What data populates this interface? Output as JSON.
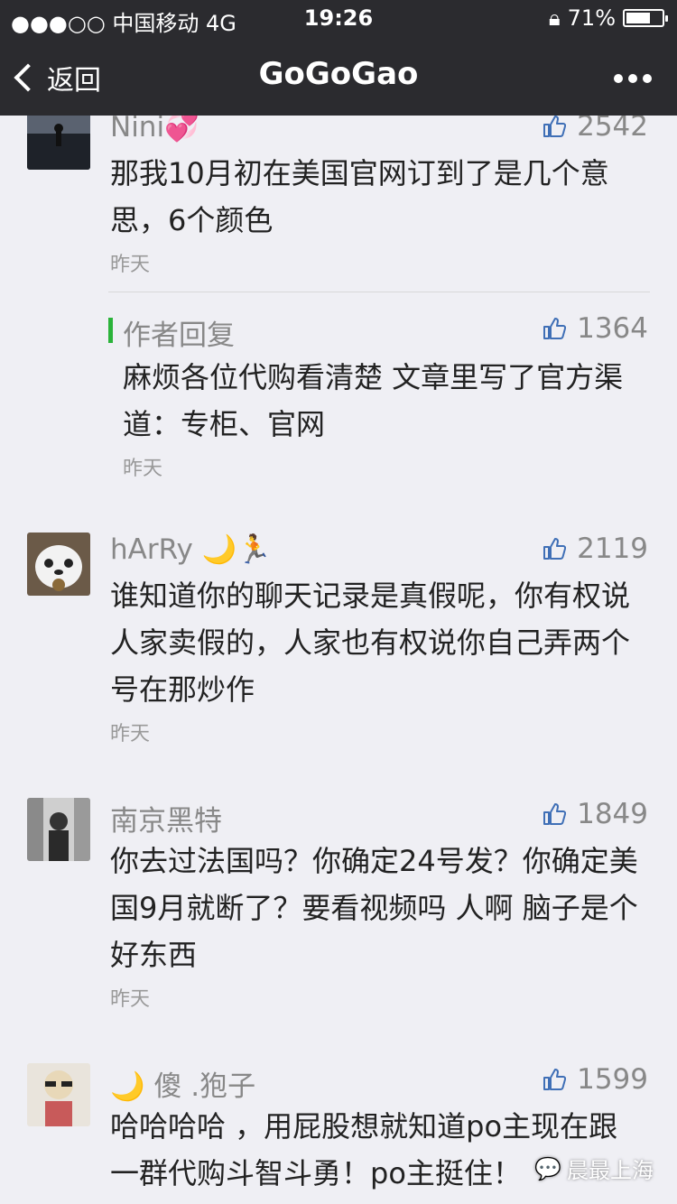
{
  "status_bar": {
    "carrier": "●●●○○ 中国移动  4G",
    "time": "19:26",
    "battery": "71%",
    "battery_level": 0.71
  },
  "nav": {
    "back_label": "返回",
    "title": "GoGoGao"
  },
  "comments": [
    {
      "name": "Nini💞",
      "likes": "2542",
      "text": "那我10月初在美国官网订到了是几个意思，6个颜色",
      "time": "昨天"
    },
    {
      "name": "hArRy 🌙🏃",
      "likes": "2119",
      "text": "谁知道你的聊天记录是真假呢，你有权说人家卖假的，人家也有权说你自己弄两个号在那炒作",
      "time": "昨天"
    },
    {
      "name": "南京黑特",
      "likes": "1849",
      "text": "你去过法国吗？你确定24号发？你确定美国9月就断了？要看视频吗 人啊 脑子是个好东西",
      "time": "昨天"
    },
    {
      "name": "🌙       傻 .狍子",
      "likes": "1599",
      "text": "哈哈哈哈 ，用屁股想就知道po主现在跟一群代购斗智斗勇！po主挺住！",
      "time": ""
    }
  ],
  "author_reply": {
    "label": "作者回复",
    "likes": "1364",
    "text": "麻烦各位代购看清楚 文章里写了官方渠道：专柜、官网",
    "time": "昨天"
  },
  "watermark": "晨最上海",
  "colors": {
    "bar_bg": "#2b2b2f",
    "page_bg": "#efeff4",
    "reply_accent": "#2bb33a",
    "thumb_blue": "#3f6fb6"
  }
}
